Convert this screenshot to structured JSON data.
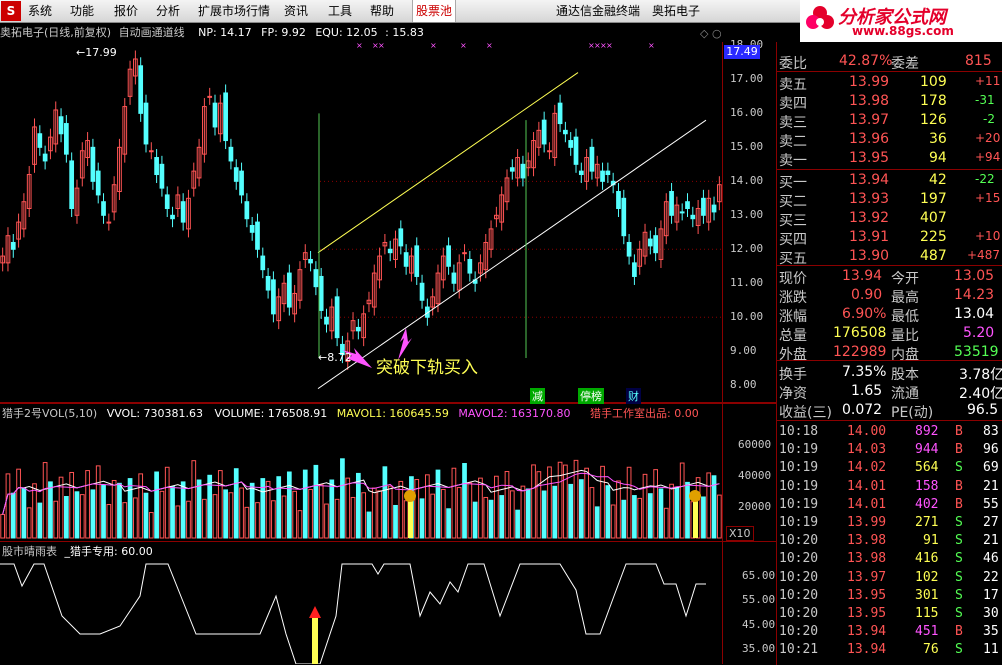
{
  "menubar": {
    "logo_label": "S",
    "items": [
      "系统",
      "功能",
      "报价",
      "分析",
      "扩展市场行情",
      "资讯",
      "工具",
      "帮助"
    ],
    "highlight": "股票池",
    "right_items": [
      "通达信金融终端",
      "奥拓电子"
    ]
  },
  "site_logo": {
    "title": "分析家公式网",
    "url_text": "www.88gs.com"
  },
  "main_chart": {
    "stock_title": "奥拓电子(日线,前复权)",
    "indicator_name": "自动画通道线",
    "np": "NP: 14.17",
    "fp": "FP: 9.92",
    "equ": "EQU: 12.05",
    "extra": ": 15.83",
    "max_label": "17.99",
    "min_label": "8.72",
    "current_price_tag": "17.49",
    "y_ticks": [
      "18.00",
      "17.00",
      "16.00",
      "15.00",
      "14.00",
      "13.00",
      "12.00",
      "11.00",
      "10.00",
      "9.00",
      "8.00"
    ],
    "annotation": "突破下轨买入",
    "tags": [
      "减",
      "停榜",
      "财"
    ]
  },
  "volume_panel": {
    "name": "猎手2号VOL(5,10)",
    "vvol": "VVOL: 730381.63",
    "volume": "VOLUME: 176508.91",
    "mavol1": "MAVOL1: 160645.59",
    "mavol2": "MAVOL2: 163170.80",
    "credit": "猎手工作室出品: 0.00",
    "y_ticks": [
      "60000",
      "40000",
      "20000"
    ],
    "unit": "X10"
  },
  "indicator_panel": {
    "name": "股市晴雨表",
    "sub": "_猎手专用: 60.00",
    "y_ticks": [
      "65.00",
      "55.00",
      "45.00",
      "35.00"
    ]
  },
  "chart_data": {
    "type": "candlestick",
    "ylim": [
      8,
      18
    ],
    "channel_upper": "yellow line",
    "channel_lower": "white line"
  },
  "quote": {
    "weibi": {
      "label": "委比",
      "value": "42.87%",
      "label2": "委差",
      "value2": "815"
    },
    "sells": [
      {
        "label": "卖五",
        "price": "13.99",
        "vol": "109",
        "chg": "+11"
      },
      {
        "label": "卖四",
        "price": "13.98",
        "vol": "178",
        "chg": "-31"
      },
      {
        "label": "卖三",
        "price": "13.97",
        "vol": "126",
        "chg": "-2"
      },
      {
        "label": "卖二",
        "price": "13.96",
        "vol": "36",
        "chg": "+20"
      },
      {
        "label": "卖一",
        "price": "13.95",
        "vol": "94",
        "chg": "+94"
      }
    ],
    "buys": [
      {
        "label": "买一",
        "price": "13.94",
        "vol": "42",
        "chg": "-22"
      },
      {
        "label": "买二",
        "price": "13.93",
        "vol": "197",
        "chg": "+15"
      },
      {
        "label": "买三",
        "price": "13.92",
        "vol": "407",
        "chg": ""
      },
      {
        "label": "买四",
        "price": "13.91",
        "vol": "225",
        "chg": "+10"
      },
      {
        "label": "买五",
        "price": "13.90",
        "vol": "487",
        "chg": "+487"
      }
    ],
    "stats": [
      {
        "l1": "现价",
        "v1": "13.94",
        "l2": "今开",
        "v2": "13.05"
      },
      {
        "l1": "涨跌",
        "v1": "0.90",
        "l2": "最高",
        "v2": "14.23"
      },
      {
        "l1": "涨幅",
        "v1": "6.90%",
        "l2": "最低",
        "v2": "13.04"
      },
      {
        "l1": "总量",
        "v1": "176508",
        "l2": "量比",
        "v2": "5.20"
      },
      {
        "l1": "外盘",
        "v1": "122989",
        "l2": "内盘",
        "v2": "53519"
      }
    ],
    "stats2": [
      {
        "l1": "换手",
        "v1": "7.35%",
        "l2": "股本",
        "v2": "3.78亿"
      },
      {
        "l1": "净资",
        "v1": "1.65",
        "l2": "流通",
        "v2": "2.40亿"
      },
      {
        "l1": "收益(三)",
        "v1": "0.072",
        "l2": "PE(动)",
        "v2": "96.5"
      }
    ],
    "ticks": [
      {
        "t": "10:18",
        "p": "14.00",
        "v": "892",
        "s": "B",
        "n": "83"
      },
      {
        "t": "10:19",
        "p": "14.03",
        "v": "944",
        "s": "B",
        "n": "96"
      },
      {
        "t": "10:19",
        "p": "14.02",
        "v": "564",
        "s": "S",
        "n": "69"
      },
      {
        "t": "10:19",
        "p": "14.01",
        "v": "158",
        "s": "B",
        "n": "21"
      },
      {
        "t": "10:19",
        "p": "14.01",
        "v": "402",
        "s": "B",
        "n": "55"
      },
      {
        "t": "10:19",
        "p": "13.99",
        "v": "271",
        "s": "S",
        "n": "27"
      },
      {
        "t": "10:20",
        "p": "13.98",
        "v": "91",
        "s": "S",
        "n": "21"
      },
      {
        "t": "10:20",
        "p": "13.98",
        "v": "416",
        "s": "S",
        "n": "46"
      },
      {
        "t": "10:20",
        "p": "13.97",
        "v": "102",
        "s": "S",
        "n": "22"
      },
      {
        "t": "10:20",
        "p": "13.95",
        "v": "301",
        "s": "S",
        "n": "17"
      },
      {
        "t": "10:20",
        "p": "13.95",
        "v": "115",
        "s": "S",
        "n": "30"
      },
      {
        "t": "10:20",
        "p": "13.94",
        "v": "451",
        "s": "B",
        "n": "35"
      },
      {
        "t": "10:21",
        "p": "13.94",
        "v": "76",
        "s": "S",
        "n": "11"
      }
    ]
  },
  "colors": {
    "up": "#ff5454",
    "down": "#54ffff",
    "vol_up": "#ff5454",
    "magenta": "#ff54ff",
    "yellow": "#ffff54",
    "panel_border": "#8b0000"
  }
}
